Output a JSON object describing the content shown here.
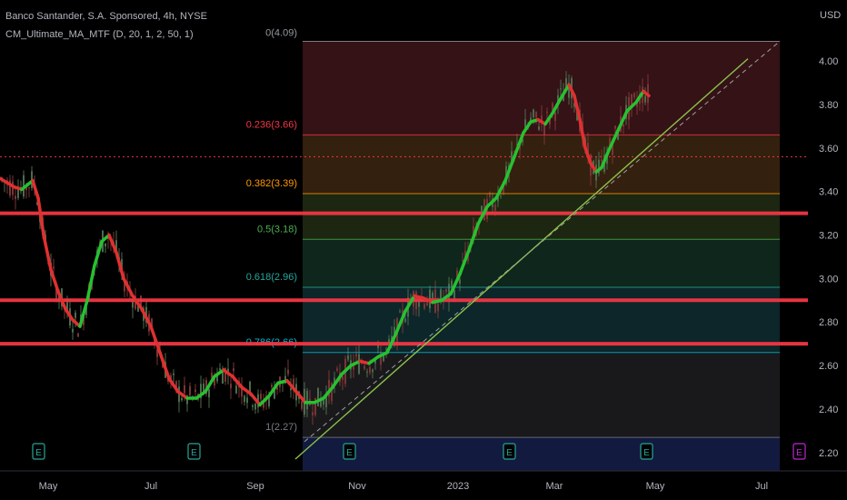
{
  "header": {
    "title": "Banco Santander, S.A. Sponsored, 4h, NYSE",
    "indicator": "CM_Ultimate_MA_MTF (D, 20, 1, 2, 50, 1)"
  },
  "chart_data": {
    "type": "line",
    "currency": "USD",
    "ylim": [
      2.12,
      4.28
    ],
    "y_ticks": [
      "4.00",
      "3.80",
      "3.60",
      "3.40",
      "3.20",
      "3.00",
      "2.80",
      "2.60",
      "2.40",
      "2.20"
    ],
    "x_labels": [
      "May",
      "Jul",
      "Sep",
      "Nov",
      "2023",
      "Mar",
      "May",
      "Jul"
    ],
    "current_price": {
      "label": "3.56",
      "value": 3.56,
      "color": "#f23645"
    },
    "horizontal_levels": [
      {
        "label": "3.30",
        "value": 3.3
      },
      {
        "label": "2.90",
        "value": 2.9
      },
      {
        "label": "2.70",
        "value": 2.7
      }
    ],
    "fibonacci": [
      {
        "label": "0(4.09)",
        "value": 4.09,
        "color": "#9598a1"
      },
      {
        "label": "0.236(3.66)",
        "value": 3.66,
        "color": "#f23645"
      },
      {
        "label": "0.382(3.39)",
        "value": 3.39,
        "color": "#ff9800"
      },
      {
        "label": "0.5(3.18)",
        "value": 3.18,
        "color": "#4caf50"
      },
      {
        "label": "0.618(2.96)",
        "value": 2.96,
        "color": "#26a69a"
      },
      {
        "label": "0.786(2.66)",
        "value": 2.66,
        "color": "#00bcd4"
      },
      {
        "label": "1(2.27)",
        "value": 2.27,
        "color": "#787b86"
      }
    ],
    "fib_zone_colors": [
      "#3a1418",
      "#3a2310",
      "#1f2a12",
      "#0f2a1e",
      "#0d2a2e",
      "#1c1c1f",
      "#121a3f"
    ],
    "moving_average": {
      "rising_color": "#26c130",
      "falling_color": "#e03030",
      "points": [
        [
          0,
          3.46
        ],
        [
          8,
          3.44
        ],
        [
          16,
          3.42
        ],
        [
          24,
          3.41
        ],
        [
          30,
          3.43
        ],
        [
          36,
          3.45
        ],
        [
          42,
          3.37
        ],
        [
          48,
          3.2
        ],
        [
          56,
          3.04
        ],
        [
          64,
          2.94
        ],
        [
          72,
          2.86
        ],
        [
          80,
          2.81
        ],
        [
          88,
          2.78
        ],
        [
          96,
          2.9
        ],
        [
          104,
          3.06
        ],
        [
          112,
          3.17
        ],
        [
          120,
          3.2
        ],
        [
          128,
          3.12
        ],
        [
          136,
          3.0
        ],
        [
          146,
          2.92
        ],
        [
          156,
          2.86
        ],
        [
          166,
          2.78
        ],
        [
          176,
          2.66
        ],
        [
          186,
          2.54
        ],
        [
          196,
          2.48
        ],
        [
          206,
          2.45
        ],
        [
          216,
          2.45
        ],
        [
          226,
          2.48
        ],
        [
          236,
          2.55
        ],
        [
          246,
          2.58
        ],
        [
          256,
          2.55
        ],
        [
          266,
          2.5
        ],
        [
          276,
          2.47
        ],
        [
          286,
          2.42
        ],
        [
          296,
          2.46
        ],
        [
          306,
          2.52
        ],
        [
          316,
          2.53
        ],
        [
          326,
          2.48
        ],
        [
          336,
          2.43
        ],
        [
          346,
          2.43
        ],
        [
          356,
          2.45
        ],
        [
          366,
          2.5
        ],
        [
          376,
          2.56
        ],
        [
          386,
          2.6
        ],
        [
          396,
          2.62
        ],
        [
          406,
          2.61
        ],
        [
          416,
          2.64
        ],
        [
          426,
          2.66
        ],
        [
          436,
          2.75
        ],
        [
          446,
          2.85
        ],
        [
          456,
          2.92
        ],
        [
          466,
          2.91
        ],
        [
          476,
          2.89
        ],
        [
          486,
          2.9
        ],
        [
          496,
          2.93
        ],
        [
          506,
          3.02
        ],
        [
          516,
          3.13
        ],
        [
          526,
          3.25
        ],
        [
          536,
          3.33
        ],
        [
          546,
          3.37
        ],
        [
          556,
          3.45
        ],
        [
          566,
          3.56
        ],
        [
          576,
          3.67
        ],
        [
          584,
          3.72
        ],
        [
          592,
          3.73
        ],
        [
          600,
          3.71
        ],
        [
          608,
          3.76
        ],
        [
          616,
          3.82
        ],
        [
          626,
          3.89
        ],
        [
          632,
          3.84
        ],
        [
          638,
          3.73
        ],
        [
          644,
          3.6
        ],
        [
          650,
          3.53
        ],
        [
          656,
          3.49
        ],
        [
          662,
          3.51
        ],
        [
          670,
          3.59
        ],
        [
          680,
          3.68
        ],
        [
          690,
          3.77
        ],
        [
          700,
          3.81
        ],
        [
          708,
          3.86
        ],
        [
          714,
          3.84
        ]
      ]
    },
    "trendline": {
      "start": [
        325,
        2.17
      ],
      "end": [
        823,
        4.01
      ],
      "color": "#8bc34a"
    },
    "dashed_line": {
      "start": [
        335,
        2.25
      ],
      "end": [
        858,
        4.09
      ],
      "color": "#9e9e9e"
    },
    "earnings_markers": [
      "E",
      "E",
      "E",
      "E",
      "E",
      "E"
    ]
  }
}
